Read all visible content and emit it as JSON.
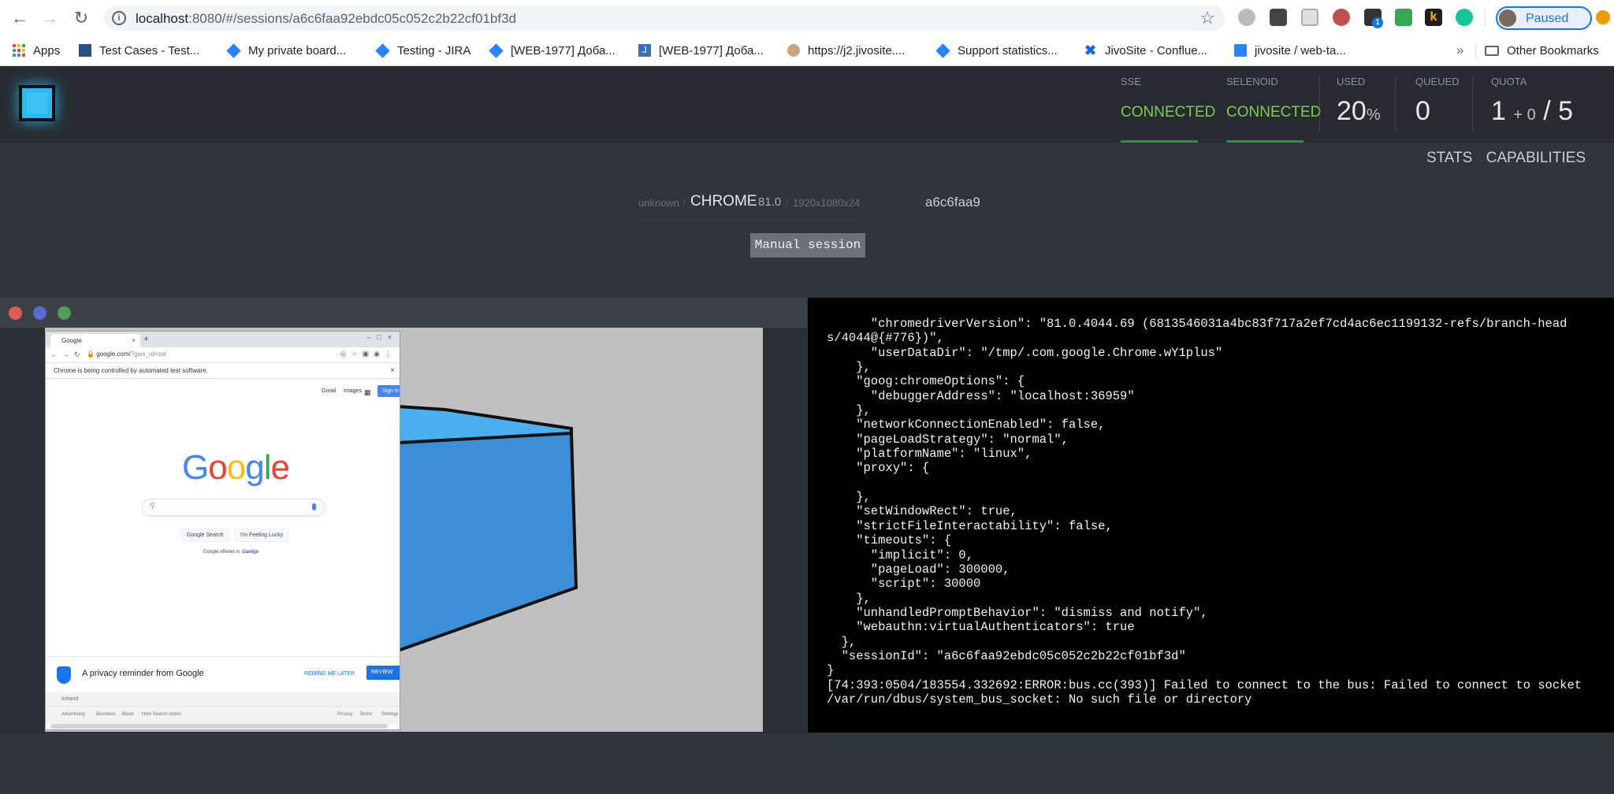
{
  "browser": {
    "url_host": "localhost",
    "url_path": ":8080/#/sessions/a6c6faa92ebdc05c052c2b22cf01bf3d",
    "profile_label": "Paused",
    "extension_badge": "1"
  },
  "bookmarks": [
    {
      "label": "Apps",
      "icon": "apps-grid-icon"
    },
    {
      "label": "Test Cases - Test...",
      "icon": "testrail-icon"
    },
    {
      "label": "My private board...",
      "icon": "jira-icon"
    },
    {
      "label": "Testing - JIRA",
      "icon": "jira-icon"
    },
    {
      "label": "[WEB-1977] Доба...",
      "icon": "jira-icon"
    },
    {
      "label": "[WEB-1977] Доба...",
      "icon": "j-icon"
    },
    {
      "label": "https://j2.jivosite....",
      "icon": "jivo-icon"
    },
    {
      "label": "Support statistics...",
      "icon": "jira-icon"
    },
    {
      "label": "JivoSite - Conflue...",
      "icon": "confluence-icon"
    },
    {
      "label": "jivosite / web-ta...",
      "icon": "bitbucket-icon"
    },
    {
      "label": "Other Bookmarks",
      "icon": "folder-icon"
    }
  ],
  "bookmarks_overflow": "»",
  "header": {
    "sse": {
      "title": "SSE",
      "value": "CONNECTED"
    },
    "selenoid": {
      "title": "SELENOID",
      "value": "CONNECTED"
    },
    "used": {
      "title": "USED",
      "value": "20",
      "unit": "%"
    },
    "queued": {
      "title": "QUEUED",
      "value": "0"
    },
    "quota": {
      "title": "QUOTA",
      "used": "1",
      "plus": "+ 0",
      "total": "/ 5"
    }
  },
  "links": {
    "stats": "STATS",
    "capabilities": "CAPABILITIES"
  },
  "session": {
    "platform": "unknown",
    "browser": "CHROME",
    "version": "81.0",
    "resolution": "1920x1080x24",
    "id_short": "a6c6faa9",
    "manual_label": "Manual session"
  },
  "inner_browser": {
    "tab_title": "Google",
    "url": "google.com/",
    "url_param": "?gws_rd=ssl",
    "infobar": "Chrome is being controlled by automated test software.",
    "top_links": [
      "Gmail",
      "Images"
    ],
    "sign_in": "Sign in",
    "search_button": "Google Search",
    "lucky_button": "I'm Feeling Lucky",
    "offered_in": "Google offered in:",
    "offered_lang": "Gaeilge",
    "privacy_text": "A privacy reminder from Google",
    "remind_later": "REMIND ME LATER",
    "review_now": "REVIEW NOW",
    "country": "Ireland",
    "footer_left": [
      "Advertising",
      "Business",
      "About",
      "How Search works"
    ],
    "footer_right": [
      "Privacy",
      "Terms",
      "Settings"
    ]
  },
  "log_lines": [
    "      \"chromedriverVersion\": \"81.0.4044.69 (6813546031a4bc83f717a2ef7cd4ac6ec1199132-refs/branch-head",
    "s/4044@{#776})\",",
    "      \"userDataDir\": \"/tmp/.com.google.Chrome.wY1plus\"",
    "    },",
    "    \"goog:chromeOptions\": {",
    "      \"debuggerAddress\": \"localhost:36959\"",
    "    },",
    "    \"networkConnectionEnabled\": false,",
    "    \"pageLoadStrategy\": \"normal\",",
    "    \"platformName\": \"linux\",",
    "    \"proxy\": {",
    "",
    "    },",
    "    \"setWindowRect\": true,",
    "    \"strictFileInteractability\": false,",
    "    \"timeouts\": {",
    "      \"implicit\": 0,",
    "      \"pageLoad\": 300000,",
    "      \"script\": 30000",
    "    },",
    "    \"unhandledPromptBehavior\": \"dismiss and notify\",",
    "    \"webauthn:virtualAuthenticators\": true",
    "  },",
    "  \"sessionId\": \"a6c6faa92ebdc05c052c2b22cf01bf3d\"",
    "}",
    "[74:393:0504/183554.332692:ERROR:bus.cc(393)] Failed to connect to the bus: Failed to connect to socket",
    "/var/run/dbus/system_bus_socket: No such file or directory"
  ],
  "colors": {
    "connected": "#7ccb55",
    "header_bg": "#272b2f",
    "page_bg": "#2f353b",
    "accent": "#30b6f2"
  }
}
